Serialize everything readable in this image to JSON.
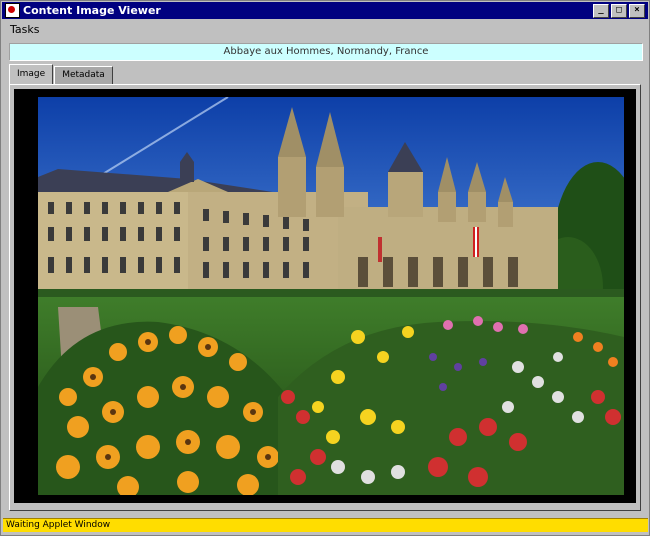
{
  "window": {
    "title": "Content Image Viewer",
    "minimize_label": "_",
    "maximize_label": "□",
    "close_label": "×"
  },
  "menu": {
    "items": [
      {
        "label": "Tasks"
      }
    ]
  },
  "caption": {
    "text": "Abbaye aux Hommes, Normandy, France"
  },
  "tabs": [
    {
      "label": "Image",
      "active": true
    },
    {
      "label": "Metadata",
      "active": false
    }
  ],
  "photo": {
    "subject": "abbey-with-flower-garden"
  },
  "status": {
    "text": "Waiting Applet Window"
  },
  "colors": {
    "titlebar": "#000080",
    "caption_bg": "#ccffff",
    "status_bg": "#ffdd00"
  }
}
